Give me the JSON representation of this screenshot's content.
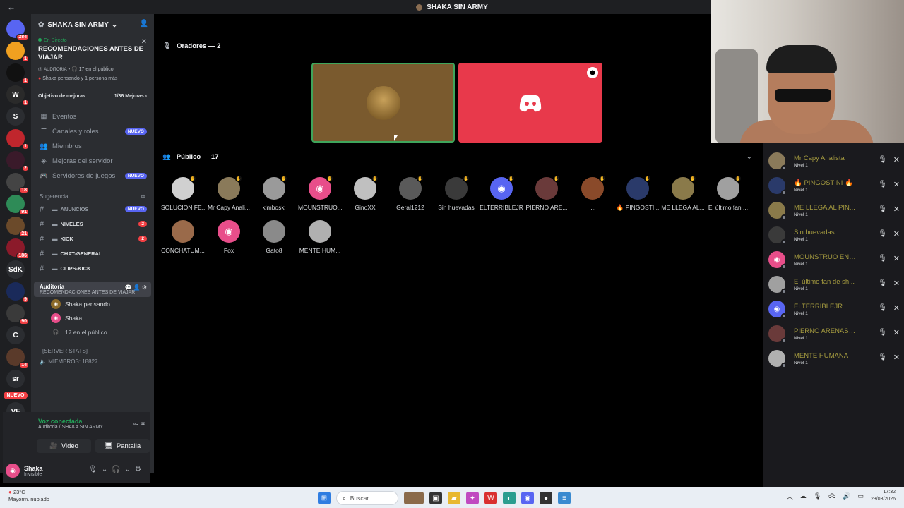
{
  "window": {
    "title": "SHAKA SIN ARMY",
    "back_icon": "back-arrow-icon"
  },
  "server_rail": {
    "items": [
      {
        "label": "",
        "badge": "284",
        "color": "#5865f2"
      },
      {
        "label": "",
        "badge": "1",
        "color": "#f0a020"
      },
      {
        "label": "",
        "badge": "1",
        "color": "#111111"
      },
      {
        "label": "W",
        "badge": "1",
        "color": "#2a2a2a"
      },
      {
        "label": "S",
        "badge": "",
        "color": "#2b2d31"
      },
      {
        "label": "",
        "badge": "1",
        "color": "#c0262d"
      },
      {
        "label": "",
        "badge": "2",
        "color": "#3a1a2a"
      },
      {
        "label": "",
        "badge": "18",
        "color": "#444444"
      },
      {
        "label": "",
        "badge": "91",
        "color": "#2e8b57"
      },
      {
        "label": "",
        "badge": "21",
        "color": "#6b4a2a"
      },
      {
        "label": "",
        "badge": "186",
        "color": "#8b1a2a"
      },
      {
        "label": "SdK",
        "badge": "",
        "color": "#2b2d31"
      },
      {
        "label": "",
        "badge": "9",
        "color": "#1a2a5a"
      },
      {
        "label": "",
        "badge": "90",
        "color": "#3a3a3a"
      },
      {
        "label": "C",
        "badge": "",
        "color": "#2b2d31"
      },
      {
        "label": "",
        "badge": "14",
        "color": "#5a3a2a"
      },
      {
        "label": "sr",
        "badge": "",
        "color": "#2b2d31"
      },
      {
        "label": "VF",
        "badge": "",
        "color": "#2b2d31"
      }
    ],
    "nuevo_label": "NUEVO"
  },
  "sidebar": {
    "server_name": "SHAKA SIN ARMY",
    "event": {
      "status": "En Directo",
      "title": "RECOMENDACIONES ANTES DE VIAJAR",
      "channel": "Auditoria",
      "audience": "17 en el público",
      "speakers": "Shaka pensando y 1 persona más"
    },
    "goal": {
      "label": "Objetivo de mejoras",
      "progress": "1/36 Mejoras"
    },
    "nav": [
      {
        "label": "Eventos",
        "icon": "calendar-icon",
        "pill": ""
      },
      {
        "label": "Canales y roles",
        "icon": "channels-icon",
        "pill": "NUEVO"
      },
      {
        "label": "Miembros",
        "icon": "members-icon",
        "pill": ""
      },
      {
        "label": "Mejoras del servidor",
        "icon": "boost-icon",
        "pill": ""
      },
      {
        "label": "Servidores de juegos",
        "icon": "gamepad-icon",
        "pill": "NUEVO"
      }
    ],
    "category": "Sugerencia",
    "channels": [
      {
        "label": "anuncios",
        "badge": "",
        "pill": "NUEVO"
      },
      {
        "label": "niveles",
        "badge": "2",
        "pill": ""
      },
      {
        "label": "kick",
        "badge": "2",
        "pill": ""
      },
      {
        "label": "chat-general",
        "badge": "",
        "pill": ""
      },
      {
        "label": "clips-kick",
        "badge": "",
        "pill": ""
      }
    ],
    "stage_channel": {
      "name": "Auditoria",
      "topic": "RECOMENDACIONES ANTES DE VIAJAR"
    },
    "stage_users": [
      {
        "name": "Shaka pensando",
        "color": "#8b6a2a"
      },
      {
        "name": "Shaka",
        "color": "#e84e8a"
      },
      {
        "name": "17 en el público",
        "color": ""
      }
    ],
    "server_stats": "[SERVER STATS]",
    "members_stat": "miembros: 18827"
  },
  "voice_panel": {
    "status": "Voz conectada",
    "location": "Auditoria / SHAKA SIN ARMY",
    "video_label": "Video",
    "screen_label": "Pantalla"
  },
  "user": {
    "name": "Shaka",
    "status": "Invisible"
  },
  "stage": {
    "speakers_header": "Oradores — 2",
    "audience_header": "Público — 17",
    "audience": [
      {
        "name": "SOLUCION FE...",
        "color": "#d0d0d0"
      },
      {
        "name": "Mr Capy Anali...",
        "color": "#8a7a5a"
      },
      {
        "name": "kimboski",
        "color": "#9a9a9a"
      },
      {
        "name": "MOUNSTRUO...",
        "color": "#e84e8a"
      },
      {
        "name": "GinoXX",
        "color": "#c0c0c0"
      },
      {
        "name": "Geral1212",
        "color": "#5a5a5a"
      },
      {
        "name": "Sin huevadas",
        "color": "#3a3a3a"
      },
      {
        "name": "ELTERRIBLEJR",
        "color": "#5865f2"
      },
      {
        "name": "PIERNO ARE...",
        "color": "#6a3a3a"
      },
      {
        "name": "l...",
        "color": "#8a4a2a"
      },
      {
        "name": "🔥 PINGOSTI...",
        "color": "#2a3a6a"
      },
      {
        "name": "ME LLEGA AL...",
        "color": "#8a7a4a"
      },
      {
        "name": "El último fan ...",
        "color": "#a0a0a0"
      },
      {
        "name": "CONCHATUM...",
        "color": "#9a6a4a"
      },
      {
        "name": "Fox",
        "color": "#e84e8a"
      },
      {
        "name": "Gato8",
        "color": "#8a8a8a"
      },
      {
        "name": "MENTE HUM...",
        "color": "#b0b0b0"
      }
    ]
  },
  "members": [
    {
      "name": "Mr Capy Analista",
      "level": "Nivel 1",
      "color": "#8a7a5a"
    },
    {
      "name": "🔥 PINGOSTINI 🔥",
      "level": "Nivel 1",
      "color": "#2a3a6a"
    },
    {
      "name": "ME LLEGA AL PIN...",
      "level": "Nivel 1",
      "color": "#8a7a4a"
    },
    {
      "name": "Sin huevadas",
      "level": "Nivel 1",
      "color": "#3a3a3a"
    },
    {
      "name": "MOUNSTRUO EN ...",
      "level": "Nivel 1",
      "color": "#e84e8a"
    },
    {
      "name": "El último fan de sh...",
      "level": "Nivel 1",
      "color": "#a0a0a0"
    },
    {
      "name": "ELTERRIBLEJR",
      "level": "Nivel 1",
      "color": "#5865f2"
    },
    {
      "name": "PIERNO ARENAS ...",
      "level": "Nivel 1",
      "color": "#6a3a3a"
    },
    {
      "name": "MENTE HUMANA",
      "level": "Nivel 1",
      "color": "#b0b0b0"
    }
  ],
  "taskbar": {
    "temperature": "23°C",
    "weather": "Mayorm. nublado",
    "search_placeholder": "Buscar",
    "time": "17:32",
    "date": "23/03/2026"
  }
}
